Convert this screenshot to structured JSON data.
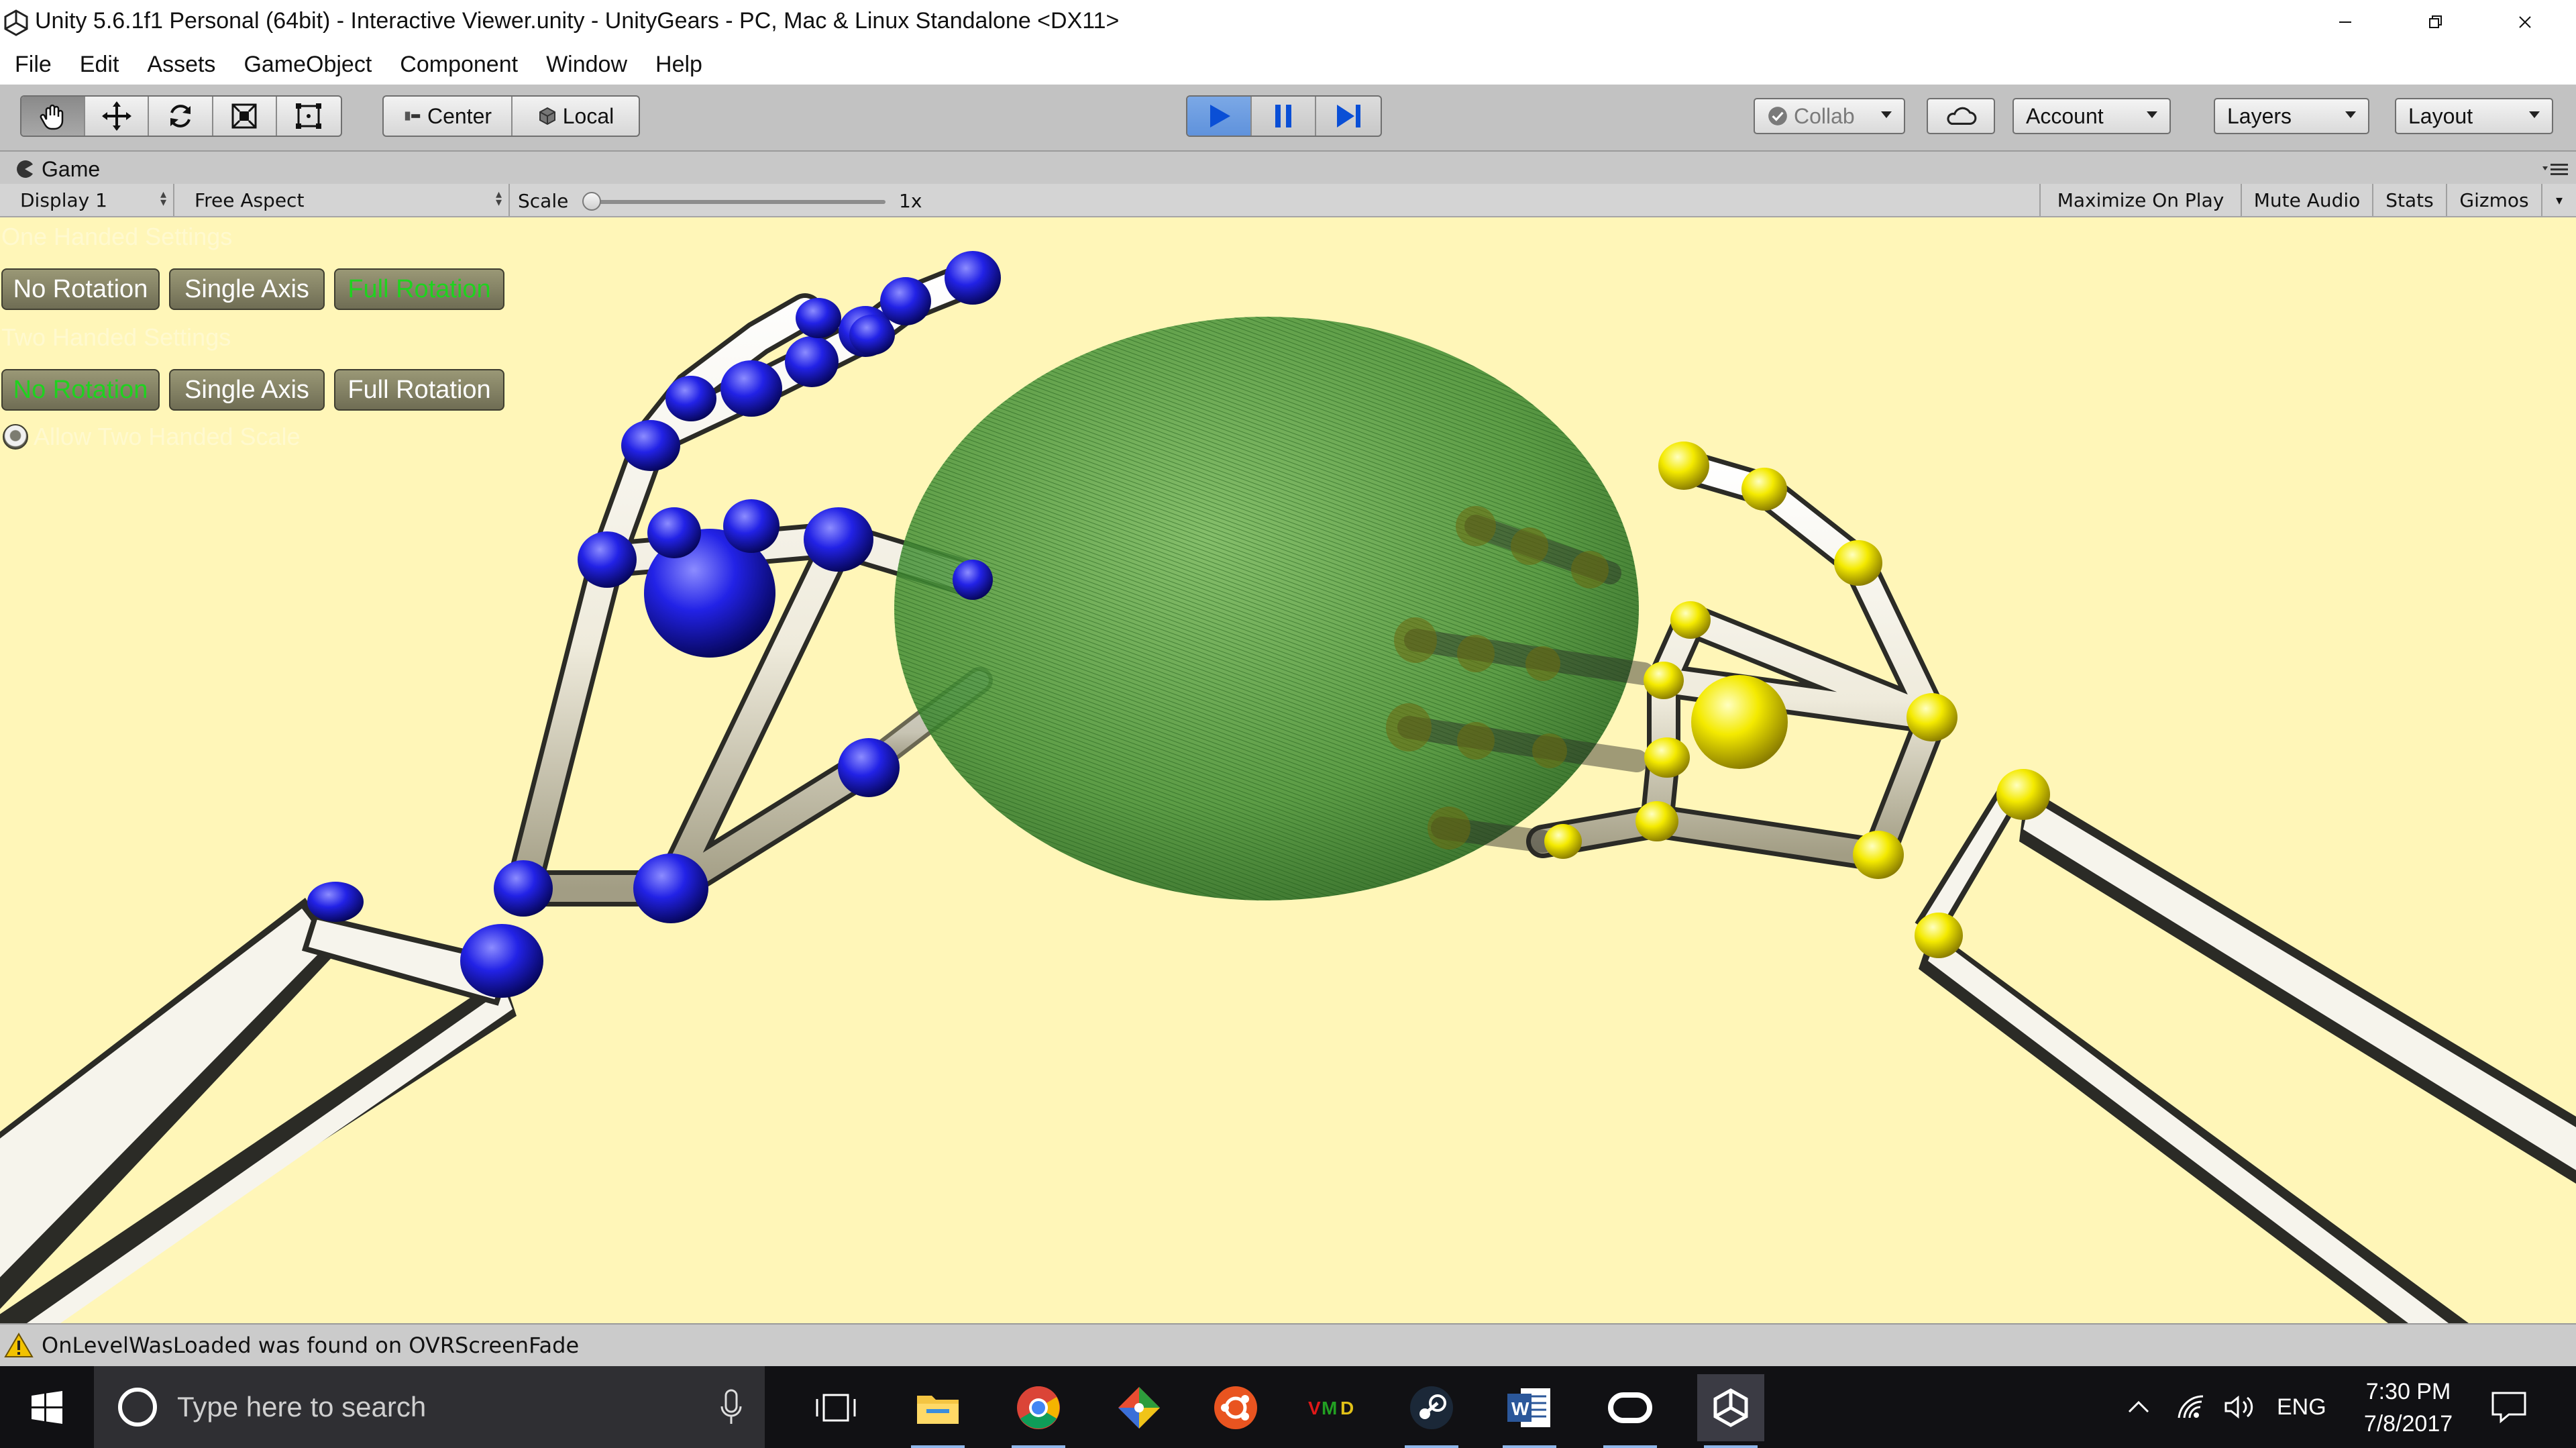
{
  "window": {
    "title": "Unity 5.6.1f1 Personal (64bit) - Interactive Viewer.unity - UnityGears - PC, Mac & Linux Standalone <DX11>",
    "icon": "unity-logo-icon",
    "controls": [
      "minimize-icon",
      "restore-icon",
      "close-icon"
    ]
  },
  "menu": [
    "File",
    "Edit",
    "Assets",
    "GameObject",
    "Component",
    "Window",
    "Help"
  ],
  "toolbar": {
    "transform_tools": [
      "hand-tool-icon",
      "move-tool-icon",
      "rotate-tool-icon",
      "scale-tool-icon",
      "rect-tool-icon"
    ],
    "active_tool": "hand-tool-icon",
    "pivot_mode": "Center",
    "pivot_rotation": "Local",
    "play_controls": [
      "play-icon",
      "pause-icon",
      "step-icon"
    ],
    "playing": true,
    "collab": "Collab",
    "account": "Account",
    "layers": "Layers",
    "layout": "Layout"
  },
  "game_view": {
    "tab_label": "Game",
    "display": "Display 1",
    "aspect": "Free Aspect",
    "scale_label": "Scale",
    "scale_value": "1x",
    "scale_level": 0,
    "buttons": [
      "Maximize On Play",
      "Mute Audio",
      "Stats",
      "Gizmos"
    ]
  },
  "gui": {
    "one_handed_label": "One Handed Settings",
    "one_handed_buttons": [
      {
        "label": "No Rotation",
        "selected": false
      },
      {
        "label": "Single Axis",
        "selected": false
      },
      {
        "label": "Full Rotation",
        "selected": true
      }
    ],
    "two_handed_label": "Two Handed Settings",
    "two_handed_buttons": [
      {
        "label": "No Rotation",
        "selected": true
      },
      {
        "label": "Single Axis",
        "selected": false
      },
      {
        "label": "Full Rotation",
        "selected": false
      }
    ],
    "toggle_label": "Allow Two Handed Scale",
    "toggle_on": false
  },
  "scene_colors": {
    "background": "#fff6b8",
    "left_hand_joint": "#1f1fe0",
    "right_hand_joint": "#f2e600",
    "bone": "#f4f1e6",
    "sphere": "#4a9a3a"
  },
  "console": {
    "icon": "warning-icon",
    "message": "OnLevelWasLoaded was found on OVRScreenFade"
  },
  "taskbar": {
    "start_icon": "windows-start-icon",
    "search_placeholder": "Type here to search",
    "apps": [
      "task-view-icon",
      "file-explorer-icon",
      "chrome-icon",
      "git-icon",
      "ubuntu-icon",
      "vmd-icon",
      "steam-icon",
      "word-icon",
      "oculus-icon",
      "unity-icon"
    ],
    "tray": {
      "language": "ENG",
      "time": "7:30 PM",
      "date": "7/8/2017"
    }
  }
}
